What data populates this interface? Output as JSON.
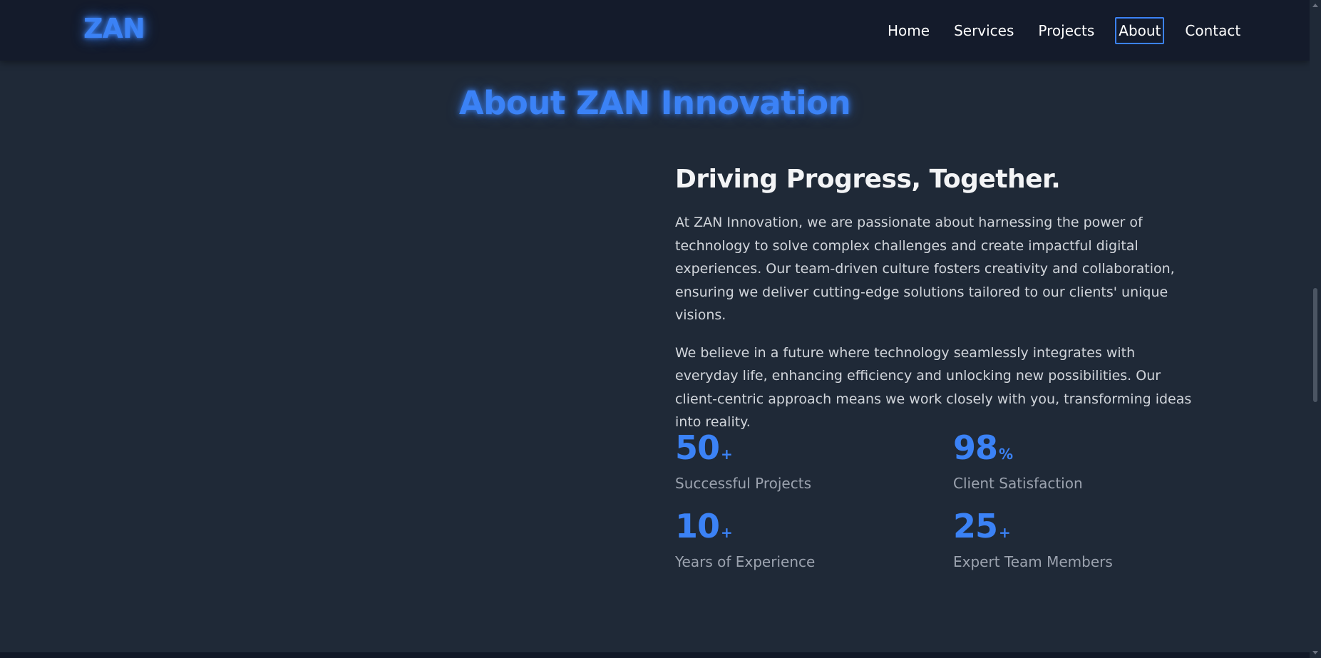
{
  "header": {
    "logo": "ZAN",
    "nav": [
      {
        "label": "Home",
        "active": false
      },
      {
        "label": "Services",
        "active": false
      },
      {
        "label": "Projects",
        "active": false
      },
      {
        "label": "About",
        "active": true
      },
      {
        "label": "Contact",
        "active": false
      }
    ]
  },
  "about": {
    "title": "About ZAN Innovation",
    "subheading": "Driving Progress, Together.",
    "paragraphs": [
      "At ZAN Innovation, we are passionate about harnessing the power of technology to solve complex challenges and create impactful digital experiences. Our team-driven culture fosters creativity and collaboration, ensuring we deliver cutting-edge solutions tailored to our clients' unique visions.",
      "We believe in a future where technology seamlessly integrates with everyday life, enhancing efficiency and unlocking new possibilities. Our client-centric approach means we work closely with you, transforming ideas into reality."
    ],
    "stats": [
      {
        "value": "50",
        "suffix": "+",
        "label": "Successful Projects"
      },
      {
        "value": "98",
        "suffix": "%",
        "label": "Client Satisfaction"
      },
      {
        "value": "10",
        "suffix": "+",
        "label": "Years of Experience"
      },
      {
        "value": "25",
        "suffix": "+",
        "label": "Expert Team Members"
      }
    ]
  },
  "colors": {
    "accent": "#3b82f6",
    "background": "#1f2937",
    "header_background": "#141b2b"
  }
}
